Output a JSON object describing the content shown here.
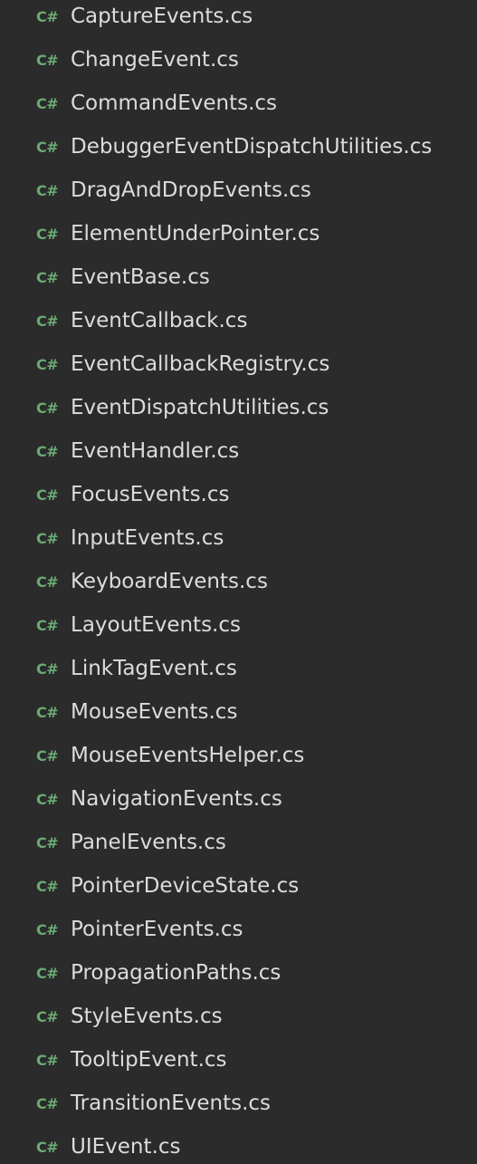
{
  "icon_label": "C#",
  "colors": {
    "background": "#2b2b2b",
    "icon": "#6aab73",
    "text": "#dcdcdc"
  },
  "files": [
    "CaptureEvents.cs",
    "ChangeEvent.cs",
    "CommandEvents.cs",
    "DebuggerEventDispatchUtilities.cs",
    "DragAndDropEvents.cs",
    "ElementUnderPointer.cs",
    "EventBase.cs",
    "EventCallback.cs",
    "EventCallbackRegistry.cs",
    "EventDispatchUtilities.cs",
    "EventHandler.cs",
    "FocusEvents.cs",
    "InputEvents.cs",
    "KeyboardEvents.cs",
    "LayoutEvents.cs",
    "LinkTagEvent.cs",
    "MouseEvents.cs",
    "MouseEventsHelper.cs",
    "NavigationEvents.cs",
    "PanelEvents.cs",
    "PointerDeviceState.cs",
    "PointerEvents.cs",
    "PropagationPaths.cs",
    "StyleEvents.cs",
    "TooltipEvent.cs",
    "TransitionEvents.cs",
    "UIEvent.cs"
  ]
}
